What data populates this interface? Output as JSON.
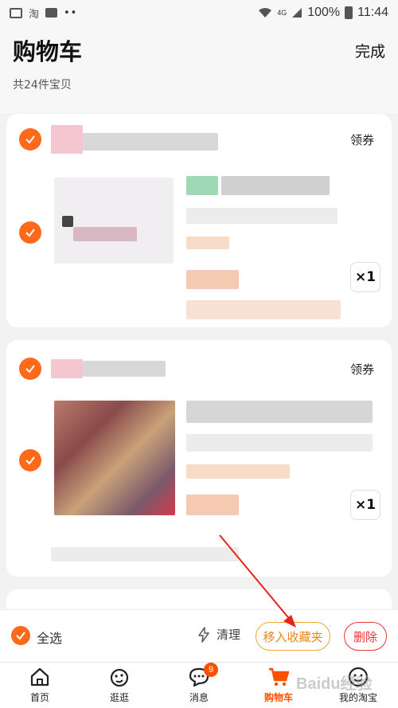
{
  "status_bar": {
    "app_label": "淘",
    "signal_label": "4G",
    "battery": "100%",
    "time": "11:44"
  },
  "header": {
    "title": "购物车",
    "done": "完成",
    "count": "共24件宝贝"
  },
  "stores": [
    {
      "coupon": "领券",
      "items": [
        {
          "quantity": "×1"
        }
      ]
    },
    {
      "coupon": "领券",
      "items": [
        {
          "quantity": "×1"
        }
      ]
    }
  ],
  "action_bar": {
    "select_all": "全选",
    "clear": "清理",
    "move_to_favorites": "移入收藏夹",
    "delete": "删除"
  },
  "tabs": [
    {
      "label": "首页",
      "icon": "home-icon"
    },
    {
      "label": "逛逛",
      "icon": "guangguang-icon"
    },
    {
      "label": "消息",
      "icon": "message-icon",
      "badge": "9"
    },
    {
      "label": "购物车",
      "icon": "cart-icon",
      "active": true
    },
    {
      "label": "我的淘宝",
      "icon": "profile-icon"
    }
  ],
  "colors": {
    "accent": "#ff6a1a",
    "active_tab": "#ff5000",
    "favorites_border": "#f2a53a",
    "delete_red": "#ee3333",
    "annotation_arrow": "#e8241c"
  },
  "watermark": "Baidu经验"
}
